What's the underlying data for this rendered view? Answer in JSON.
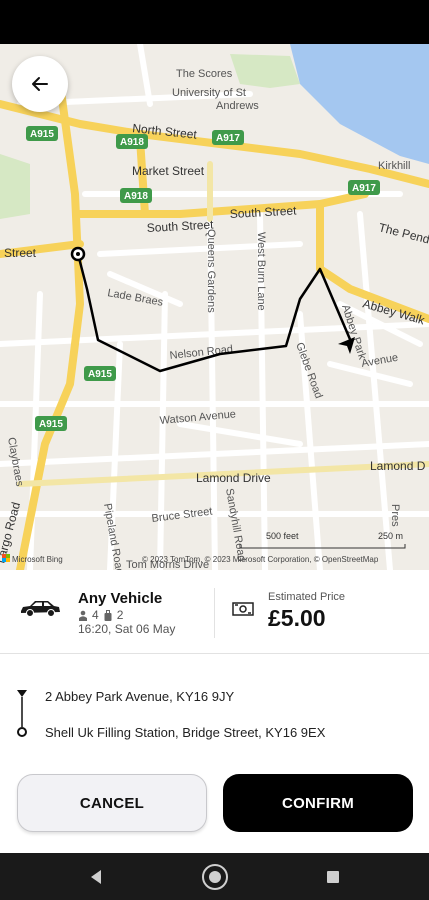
{
  "map": {
    "place_labels": {
      "the_scores": "The Scores",
      "university": "University of St Andrews",
      "north_street": "North Street",
      "market_street": "Market Street",
      "south_street_1": "South Street",
      "south_street_2": "South Street",
      "kirkhill": "Kirkhill",
      "the_pends": "The Pend",
      "street_left": "Street",
      "abbey_walk": "Abbey Walk",
      "lade_braes": "Lade Braes",
      "queens_gardens": "Queens Gardens",
      "west_burn_lane": "West Burn Lane",
      "abbey_park_avenue": "Abbey Park Avenue",
      "nelson_road": "Nelson Road",
      "glebe_road": "Glebe Road",
      "watson_avenue": "Watson Avenue",
      "lamond_drive": "Lamond Drive",
      "lamond_drive_2": "Lamond D",
      "claybraes": "Claybraes",
      "largo_road": "Largo Road",
      "pipeland_road": "Pipeland Road",
      "sandyhill_road": "Sandyhill Road",
      "bruce_street": "Bruce Street",
      "tom_morris_drive": "Tom Morris Drive",
      "pre": "Pres",
      "abbey_park_label": "Abbey Park"
    },
    "road_badges": [
      "A915",
      "A918",
      "A917",
      "A918",
      "A917",
      "A915",
      "A915"
    ],
    "scale_feet": "500 feet",
    "scale_m": "250 m",
    "attribution": "© 2023 TomTom, © 2023 Microsoft Corporation, © OpenStreetMap",
    "provider": "Microsoft Bing"
  },
  "ride": {
    "vehicle_name": "Any Vehicle",
    "passengers": "4",
    "luggage": "2",
    "time": "16:20, Sat 06 May",
    "price_label": "Estimated Price",
    "price": "£5.00"
  },
  "route": {
    "pickup": "2 Abbey Park Avenue, KY16 9JY",
    "dropoff": "Shell Uk Filling Station, Bridge Street, KY16 9EX"
  },
  "actions": {
    "cancel_label": "CANCEL",
    "confirm_label": "CONFIRM"
  },
  "colors": {
    "route_line": "#000000",
    "major_road": "#f7d25a",
    "sea": "#a4c7f0",
    "badge_green": "#3f9a4a"
  }
}
